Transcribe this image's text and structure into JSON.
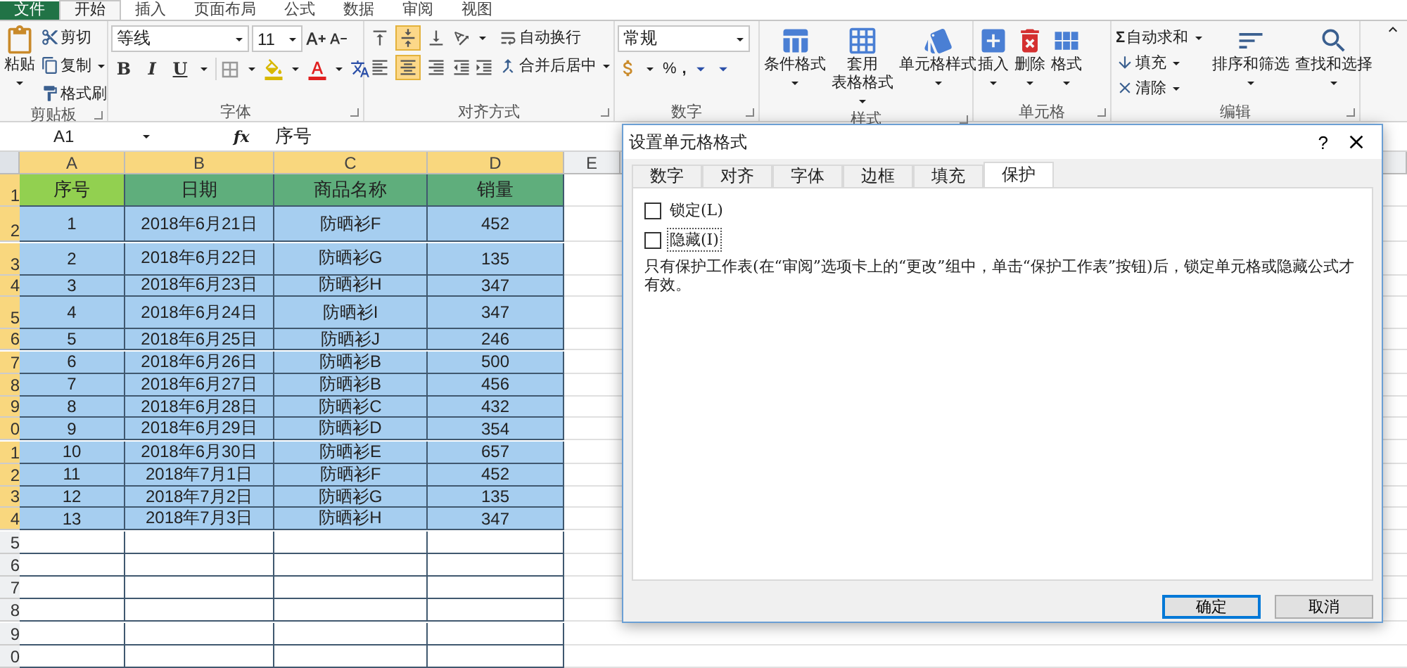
{
  "ribbon_tabs": [
    {
      "label": "文件",
      "kind": "file",
      "selected": false
    },
    {
      "label": "开始",
      "kind": "tab",
      "selected": true
    },
    {
      "label": "插入",
      "kind": "tab",
      "selected": false
    },
    {
      "label": "页面布局",
      "kind": "tab",
      "selected": false
    },
    {
      "label": "公式",
      "kind": "tab",
      "selected": false
    },
    {
      "label": "数据",
      "kind": "tab",
      "selected": false
    },
    {
      "label": "审阅",
      "kind": "tab",
      "selected": false
    },
    {
      "label": "视图",
      "kind": "tab",
      "selected": false
    }
  ],
  "clipboard": {
    "label": "剪贴板",
    "paste": "粘贴",
    "tools": [
      "剪切",
      "复制",
      "格式刷"
    ]
  },
  "font": {
    "label": "字体",
    "name": "等线",
    "size": "11",
    "styles": [
      "B",
      "I",
      "U"
    ]
  },
  "alignment": {
    "label": "对齐方式",
    "vertical": [
      {
        "selected": false
      },
      {
        "selected": true
      },
      {
        "selected": false
      }
    ],
    "horizontal": [
      {
        "selected": false
      },
      {
        "selected": true
      },
      {
        "selected": false
      }
    ],
    "wrap": "自动换行",
    "merge": "合并后居中"
  },
  "number": {
    "label": "数字",
    "format": "常规",
    "percent": "%",
    "comma": ","
  },
  "styles": {
    "label": "样式",
    "items": [
      {
        "lines": [
          "条件格式"
        ]
      },
      {
        "lines": [
          "套用",
          "表格格式"
        ]
      },
      {
        "lines": [
          "单元格样式"
        ]
      }
    ]
  },
  "cells": {
    "label": "单元格",
    "items": [
      "插入",
      "删除",
      "格式"
    ]
  },
  "editing": {
    "label": "编辑",
    "sum_symbol": "Σ",
    "tools": [
      "自动求和",
      "填充",
      "清除"
    ],
    "buttons": [
      "排序和筛选",
      "查找和选择"
    ]
  },
  "formula_bar": {
    "name_box": "A1",
    "fx": "fx",
    "formula": "序号"
  },
  "sheet": {
    "columns": [
      {
        "label": "A",
        "selected": true
      },
      {
        "label": "B",
        "selected": true
      },
      {
        "label": "C",
        "selected": true
      },
      {
        "label": "D",
        "selected": true
      },
      {
        "label": "E",
        "selected": false
      }
    ],
    "rows": [
      {
        "header": "1",
        "kind": "header",
        "selected": true,
        "cells": [
          {
            "text": "序号",
            "active": true
          },
          {
            "text": "日期",
            "active": false
          },
          {
            "text": "商品名称",
            "active": false
          },
          {
            "text": "销量",
            "active": false
          }
        ]
      },
      {
        "header": "2",
        "kind": "data",
        "selected": true,
        "cells": [
          {
            "text": "1",
            "active": false
          },
          {
            "text": "2018年6月21日",
            "active": false
          },
          {
            "text": "防晒衫F",
            "active": false
          },
          {
            "text": "452",
            "active": false
          }
        ]
      },
      {
        "header": "3",
        "kind": "data",
        "selected": true,
        "cells": [
          {
            "text": "2",
            "active": false
          },
          {
            "text": "2018年6月22日",
            "active": false
          },
          {
            "text": "防晒衫G",
            "active": false
          },
          {
            "text": "135",
            "active": false
          }
        ]
      },
      {
        "header": "4",
        "kind": "data",
        "selected": true,
        "cells": [
          {
            "text": "3",
            "active": false
          },
          {
            "text": "2018年6月23日",
            "active": false
          },
          {
            "text": "防晒衫H",
            "active": false
          },
          {
            "text": "347",
            "active": false
          }
        ]
      },
      {
        "header": "5",
        "kind": "data",
        "selected": true,
        "cells": [
          {
            "text": "4",
            "active": false
          },
          {
            "text": "2018年6月24日",
            "active": false
          },
          {
            "text": "防晒衫I",
            "active": false
          },
          {
            "text": "347",
            "active": false
          }
        ]
      },
      {
        "header": "6",
        "kind": "data",
        "selected": true,
        "cells": [
          {
            "text": "5",
            "active": false
          },
          {
            "text": "2018年6月25日",
            "active": false
          },
          {
            "text": "防晒衫J",
            "active": false
          },
          {
            "text": "246",
            "active": false
          }
        ]
      },
      {
        "header": "7",
        "kind": "data",
        "selected": true,
        "cells": [
          {
            "text": "6",
            "active": false
          },
          {
            "text": "2018年6月26日",
            "active": false
          },
          {
            "text": "防晒衫B",
            "active": false
          },
          {
            "text": "500",
            "active": false
          }
        ]
      },
      {
        "header": "8",
        "kind": "data",
        "selected": true,
        "cells": [
          {
            "text": "7",
            "active": false
          },
          {
            "text": "2018年6月27日",
            "active": false
          },
          {
            "text": "防晒衫B",
            "active": false
          },
          {
            "text": "456",
            "active": false
          }
        ]
      },
      {
        "header": "9",
        "kind": "data",
        "selected": true,
        "cells": [
          {
            "text": "8",
            "active": false
          },
          {
            "text": "2018年6月28日",
            "active": false
          },
          {
            "text": "防晒衫C",
            "active": false
          },
          {
            "text": "432",
            "active": false
          }
        ]
      },
      {
        "header": "0",
        "kind": "data",
        "selected": true,
        "cells": [
          {
            "text": "9",
            "active": false
          },
          {
            "text": "2018年6月29日",
            "active": false
          },
          {
            "text": "防晒衫D",
            "active": false
          },
          {
            "text": "354",
            "active": false
          }
        ]
      },
      {
        "header": "1",
        "kind": "data",
        "selected": true,
        "cells": [
          {
            "text": "10",
            "active": false
          },
          {
            "text": "2018年6月30日",
            "active": false
          },
          {
            "text": "防晒衫E",
            "active": false
          },
          {
            "text": "657",
            "active": false
          }
        ]
      },
      {
        "header": "2",
        "kind": "data",
        "selected": true,
        "cells": [
          {
            "text": "11",
            "active": false
          },
          {
            "text": "2018年7月1日",
            "active": false
          },
          {
            "text": "防晒衫F",
            "active": false
          },
          {
            "text": "452",
            "active": false
          }
        ]
      },
      {
        "header": "3",
        "kind": "data",
        "selected": true,
        "cells": [
          {
            "text": "12",
            "active": false
          },
          {
            "text": "2018年7月2日",
            "active": false
          },
          {
            "text": "防晒衫G",
            "active": false
          },
          {
            "text": "135",
            "active": false
          }
        ]
      },
      {
        "header": "4",
        "kind": "data",
        "selected": true,
        "cells": [
          {
            "text": "13",
            "active": false
          },
          {
            "text": "2018年7月3日",
            "active": false
          },
          {
            "text": "防晒衫H",
            "active": false
          },
          {
            "text": "347",
            "active": false
          }
        ]
      },
      {
        "header": "5",
        "kind": "empty",
        "selected": false
      },
      {
        "header": "6",
        "kind": "empty",
        "selected": false
      },
      {
        "header": "7",
        "kind": "empty",
        "selected": false
      },
      {
        "header": "8",
        "kind": "empty",
        "selected": false
      },
      {
        "header": "9",
        "kind": "empty",
        "selected": false
      },
      {
        "header": "0",
        "kind": "empty",
        "selected": false
      }
    ]
  },
  "dialog": {
    "title": "设置单元格格式",
    "help": "?",
    "tabs": [
      {
        "label": "数字",
        "selected": false
      },
      {
        "label": "对齐",
        "selected": false
      },
      {
        "label": "字体",
        "selected": false
      },
      {
        "label": "边框",
        "selected": false
      },
      {
        "label": "填充",
        "selected": false
      },
      {
        "label": "保护",
        "selected": true
      }
    ],
    "options": [
      {
        "label": "锁定(L)",
        "checked": false,
        "focused": false
      },
      {
        "label": "隐藏(I)",
        "checked": false,
        "focused": true
      }
    ],
    "note": "只有保护工作表(在“审阅”选项卡上的“更改”组中，单击“保护工作表”按钮)后，锁定单元格或隐藏公式才有效。",
    "buttons": [
      {
        "label": "确定",
        "default": true
      },
      {
        "label": "取消",
        "default": false
      }
    ]
  }
}
